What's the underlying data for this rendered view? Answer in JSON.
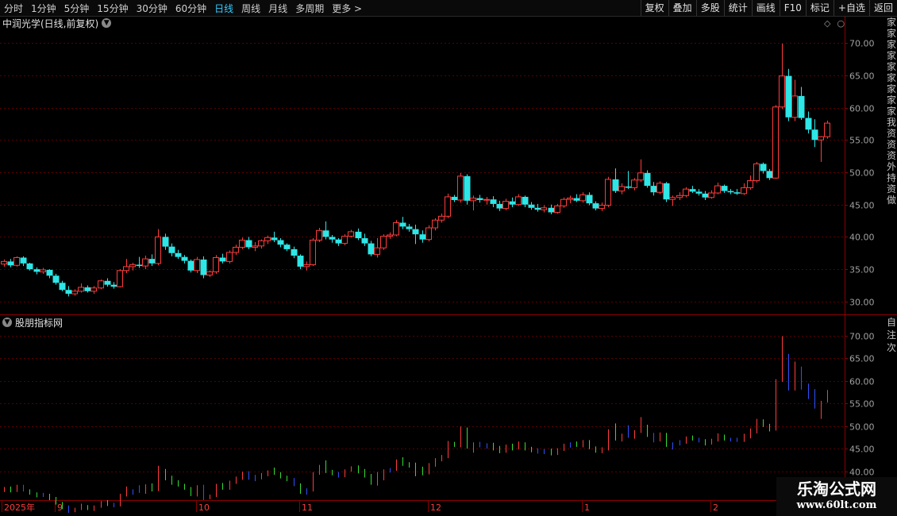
{
  "toolbar": {
    "periods": [
      "分时",
      "1分钟",
      "5分钟",
      "15分钟",
      "30分钟",
      "60分钟",
      "日线",
      "周线",
      "月线",
      "多周期",
      "更多 >"
    ],
    "active_period": "日线",
    "tools": [
      "复权",
      "叠加",
      "多股",
      "统计",
      "画线",
      "F10",
      "标记",
      "+自选",
      "返回"
    ]
  },
  "main_panel": {
    "title": "中润光学(日线,前复权)"
  },
  "indicator_panel": {
    "title": "股朋指标网"
  },
  "watermark": {
    "line1": "乐淘公式网",
    "line2": "www.60lt.com"
  },
  "side_strip": {
    "main_chars": "家家家家家家家家家我资资资外持资做",
    "ind_chars": "自注次"
  },
  "colors": {
    "up": "#ff3b3b",
    "down": "#2ee6e6",
    "grid": "#5a0000",
    "axis_text": "#a0a0a0",
    "ind_green": "#33dd33",
    "ind_blue": "#3050ff"
  },
  "chart_data": [
    {
      "type": "candlestick",
      "title": "中润光学(日线,前复权)",
      "ylim": [
        29,
        71
      ],
      "yticks": [
        "70.00",
        "65.00",
        "60.00",
        "55.00",
        "50.00",
        "45.00",
        "40.00",
        "35.00",
        "30.00"
      ],
      "xlabels": [
        "2025年",
        "9",
        "10",
        "11",
        "12",
        "1",
        "2"
      ],
      "xlabel_index": [
        0,
        8,
        30,
        46,
        66,
        90,
        110
      ],
      "ohlc": [
        [
          35.8,
          36.5,
          35.4,
          36.2
        ],
        [
          36.2,
          36.6,
          35.3,
          35.6
        ],
        [
          35.6,
          37.0,
          35.4,
          36.8
        ],
        [
          36.8,
          37.0,
          35.5,
          35.9
        ],
        [
          35.9,
          36.0,
          34.8,
          35.0
        ],
        [
          35.0,
          35.3,
          34.2,
          34.6
        ],
        [
          34.6,
          35.2,
          34.3,
          34.9
        ],
        [
          34.9,
          35.0,
          33.6,
          34.0
        ],
        [
          34.0,
          34.3,
          32.6,
          32.9
        ],
        [
          32.9,
          33.2,
          31.6,
          31.8
        ],
        [
          31.8,
          32.4,
          30.8,
          31.2
        ],
        [
          31.2,
          31.9,
          30.9,
          31.6
        ],
        [
          31.6,
          32.8,
          31.4,
          32.2
        ],
        [
          32.2,
          32.5,
          31.4,
          31.6
        ],
        [
          31.6,
          32.4,
          31.2,
          32.1
        ],
        [
          32.1,
          33.4,
          31.9,
          33.2
        ],
        [
          33.2,
          33.6,
          32.3,
          32.6
        ],
        [
          32.6,
          33.0,
          32.0,
          32.3
        ],
        [
          32.3,
          35.0,
          32.2,
          34.8
        ],
        [
          34.8,
          36.6,
          34.4,
          35.4
        ],
        [
          35.4,
          36.0,
          34.8,
          35.7
        ],
        [
          35.7,
          36.9,
          35.2,
          35.5
        ],
        [
          35.5,
          37.1,
          35.0,
          36.6
        ],
        [
          36.6,
          37.3,
          35.5,
          35.9
        ],
        [
          35.9,
          41.2,
          35.6,
          40.0
        ],
        [
          40.0,
          40.5,
          38.0,
          38.5
        ],
        [
          38.5,
          39.0,
          37.0,
          37.5
        ],
        [
          37.5,
          38.0,
          36.6,
          36.9
        ],
        [
          36.9,
          37.2,
          35.9,
          36.3
        ],
        [
          36.3,
          36.5,
          34.5,
          34.8
        ],
        [
          34.8,
          36.9,
          34.4,
          36.5
        ],
        [
          36.5,
          37.0,
          33.6,
          34.1
        ],
        [
          34.1,
          34.8,
          33.8,
          34.6
        ],
        [
          34.6,
          37.2,
          34.3,
          36.8
        ],
        [
          36.8,
          37.4,
          35.9,
          36.2
        ],
        [
          36.2,
          37.9,
          35.9,
          37.6
        ],
        [
          37.6,
          38.8,
          37.2,
          38.4
        ],
        [
          38.4,
          39.9,
          38.1,
          39.5
        ],
        [
          39.5,
          40.0,
          38.1,
          38.4
        ],
        [
          38.4,
          39.2,
          37.8,
          38.6
        ],
        [
          38.6,
          39.6,
          38.2,
          39.4
        ],
        [
          39.4,
          40.2,
          38.9,
          39.9
        ],
        [
          39.9,
          40.8,
          39.2,
          39.5
        ],
        [
          39.5,
          39.8,
          38.4,
          38.8
        ],
        [
          38.8,
          39.0,
          37.8,
          38.1
        ],
        [
          38.1,
          38.5,
          36.7,
          37.1
        ],
        [
          37.1,
          37.3,
          35.0,
          35.4
        ],
        [
          35.4,
          36.2,
          34.8,
          35.7
        ],
        [
          35.7,
          39.8,
          35.5,
          39.5
        ],
        [
          39.5,
          41.4,
          39.2,
          41.0
        ],
        [
          41.0,
          42.4,
          39.6,
          40.0
        ],
        [
          40.0,
          40.3,
          39.1,
          39.6
        ],
        [
          39.6,
          39.8,
          38.6,
          39.0
        ],
        [
          39.0,
          40.4,
          38.7,
          40.1
        ],
        [
          40.1,
          41.1,
          39.9,
          40.8
        ],
        [
          40.8,
          41.3,
          39.5,
          39.8
        ],
        [
          39.8,
          40.5,
          38.6,
          39.0
        ],
        [
          39.0,
          39.4,
          37.0,
          37.3
        ],
        [
          37.3,
          39.8,
          36.8,
          38.3
        ],
        [
          38.3,
          40.4,
          38.0,
          40.1
        ],
        [
          40.1,
          40.7,
          39.7,
          40.3
        ],
        [
          40.3,
          42.6,
          40.1,
          42.2
        ],
        [
          42.2,
          43.1,
          41.2,
          41.6
        ],
        [
          41.6,
          42.0,
          40.8,
          41.2
        ],
        [
          41.2,
          41.9,
          38.9,
          40.4
        ],
        [
          40.4,
          41.0,
          39.1,
          39.6
        ],
        [
          39.6,
          41.8,
          39.3,
          41.4
        ],
        [
          41.4,
          42.9,
          41.0,
          42.6
        ],
        [
          42.6,
          43.6,
          42.2,
          43.2
        ],
        [
          43.2,
          46.7,
          42.9,
          46.2
        ],
        [
          46.2,
          46.5,
          45.4,
          45.7
        ],
        [
          45.7,
          49.9,
          45.3,
          49.4
        ],
        [
          49.4,
          49.7,
          45.0,
          45.6
        ],
        [
          45.6,
          46.4,
          44.1,
          46.0
        ],
        [
          46.0,
          46.5,
          45.3,
          45.7
        ],
        [
          45.7,
          46.2,
          45.0,
          45.8
        ],
        [
          45.8,
          46.3,
          44.6,
          45.1
        ],
        [
          45.1,
          45.6,
          44.0,
          44.4
        ],
        [
          44.4,
          45.9,
          44.1,
          45.5
        ],
        [
          45.5,
          46.1,
          44.6,
          45.0
        ],
        [
          45.0,
          46.6,
          44.8,
          46.2
        ],
        [
          46.2,
          46.4,
          44.6,
          45.0
        ],
        [
          45.0,
          45.4,
          44.2,
          44.5
        ],
        [
          44.5,
          45.1,
          43.9,
          44.2
        ],
        [
          44.2,
          44.9,
          43.8,
          44.5
        ],
        [
          44.5,
          45.0,
          43.5,
          43.8
        ],
        [
          43.8,
          45.1,
          43.6,
          44.8
        ],
        [
          44.8,
          46.1,
          44.5,
          45.8
        ],
        [
          45.8,
          46.4,
          45.2,
          46.0
        ],
        [
          46.0,
          46.6,
          45.4,
          45.6
        ],
        [
          45.6,
          46.9,
          45.3,
          46.5
        ],
        [
          46.5,
          46.9,
          44.9,
          45.2
        ],
        [
          45.2,
          45.5,
          44.1,
          44.4
        ],
        [
          44.4,
          45.3,
          44.0,
          44.9
        ],
        [
          44.9,
          49.3,
          44.6,
          48.9
        ],
        [
          48.9,
          50.6,
          46.8,
          47.1
        ],
        [
          47.1,
          48.3,
          46.6,
          47.8
        ],
        [
          47.8,
          50.2,
          47.4,
          47.6
        ],
        [
          47.6,
          49.1,
          47.2,
          48.8
        ],
        [
          48.8,
          52.0,
          48.5,
          49.9
        ],
        [
          49.9,
          50.3,
          47.6,
          47.9
        ],
        [
          47.9,
          48.5,
          46.4,
          46.9
        ],
        [
          46.9,
          48.6,
          46.6,
          48.3
        ],
        [
          48.3,
          48.5,
          45.4,
          45.8
        ],
        [
          45.8,
          46.4,
          44.8,
          46.1
        ],
        [
          46.1,
          46.9,
          45.7,
          46.4
        ],
        [
          46.4,
          47.7,
          46.1,
          47.4
        ],
        [
          47.4,
          47.9,
          46.8,
          47.0
        ],
        [
          47.0,
          47.4,
          46.4,
          46.7
        ],
        [
          46.7,
          47.1,
          45.7,
          46.1
        ],
        [
          46.1,
          47.2,
          45.9,
          46.8
        ],
        [
          46.8,
          48.4,
          46.6,
          47.9
        ],
        [
          47.9,
          48.1,
          46.8,
          47.1
        ],
        [
          47.1,
          47.4,
          46.6,
          46.9
        ],
        [
          46.9,
          47.4,
          46.5,
          46.7
        ],
        [
          46.7,
          48.3,
          46.5,
          47.6
        ],
        [
          47.6,
          49.5,
          47.3,
          48.7
        ],
        [
          48.7,
          51.6,
          48.4,
          51.3
        ],
        [
          51.3,
          51.5,
          49.8,
          50.2
        ],
        [
          50.2,
          50.5,
          48.8,
          49.1
        ],
        [
          49.1,
          60.4,
          49.0,
          60.1
        ],
        [
          60.1,
          69.9,
          59.8,
          64.9
        ],
        [
          64.9,
          66.0,
          57.9,
          58.5
        ],
        [
          58.5,
          64.3,
          57.9,
          61.8
        ],
        [
          61.8,
          63.2,
          58.1,
          58.4
        ],
        [
          58.4,
          59.4,
          56.0,
          56.6
        ],
        [
          56.6,
          58.2,
          53.9,
          55.0
        ],
        [
          55.0,
          55.6,
          51.6,
          55.5
        ],
        [
          55.5,
          58.0,
          55.2,
          57.6
        ]
      ]
    },
    {
      "type": "bar",
      "title": "股朋指标网",
      "ylim": [
        35,
        73
      ],
      "yticks": [
        "70.00",
        "65.00",
        "60.00",
        "55.00",
        "50.00",
        "45.00",
        "40.00"
      ],
      "note": "vertical high-low lines per day, same price series as main panel, colored red/green/blue"
    }
  ]
}
